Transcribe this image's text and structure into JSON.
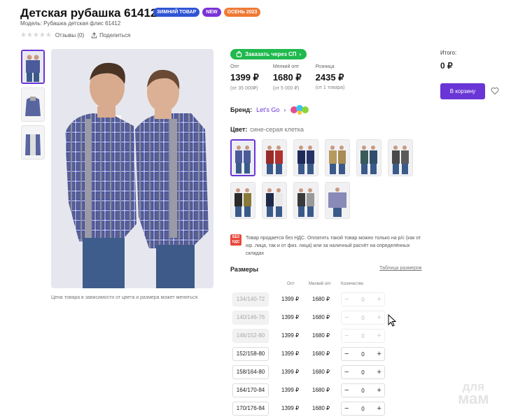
{
  "product": {
    "title": "Детская рубашка 61412",
    "badges": [
      "ЗИМНИЙ ТОВАР",
      "NEW",
      "ОСЕНЬ 2023"
    ],
    "model": "Модель: Рубашка детская флис 61412",
    "reviews": "Отзывы (0)",
    "share": "Поделиться",
    "image_caption": "Цена товара в зависимости от цвета и размера может меняться"
  },
  "offer": {
    "sp_button": "Заказать через СП",
    "prices": [
      {
        "label": "Опт",
        "value": "1399 ₽",
        "sub": "(от 35 000₽)"
      },
      {
        "label": "Мелкий опт",
        "value": "1680 ₽",
        "sub": "(от 5 000 ₽)"
      },
      {
        "label": "Розница",
        "value": "2435 ₽",
        "sub": "(от 1 товара)"
      }
    ],
    "brand_label": "Бренд:",
    "brand_name": "Let's Go",
    "color_label": "Цвет:",
    "color_value": "сине-серая клетка",
    "swatch_count": 11,
    "notice": "Товар продается без НДС. Оплатить такой товар можно только на р/с (как от юр. лица, так и от физ. лица) или за наличный расчёт на определённых складах",
    "nds_badge": [
      "БЕЗ",
      "НДС"
    ]
  },
  "sizes": {
    "heading": "Размеры",
    "table_link": "Таблица размеров",
    "col_opt": "Опт",
    "col_small": "Мелкий опт",
    "col_qty": "Количество",
    "rows": [
      {
        "size": "134/140-72",
        "opt": "1399 ₽",
        "small": "1680 ₽",
        "qty": "0",
        "disabled": true
      },
      {
        "size": "140/146-76",
        "opt": "1399 ₽",
        "small": "1680 ₽",
        "qty": "0",
        "disabled": true
      },
      {
        "size": "146/152-80",
        "opt": "1399 ₽",
        "small": "1680 ₽",
        "qty": "0",
        "disabled": true
      },
      {
        "size": "152/158-80",
        "opt": "1399 ₽",
        "small": "1680 ₽",
        "qty": "0",
        "disabled": false
      },
      {
        "size": "158/164-80",
        "opt": "1399 ₽",
        "small": "1680 ₽",
        "qty": "0",
        "disabled": false
      },
      {
        "size": "164/170-84",
        "opt": "1399 ₽",
        "small": "1680 ₽",
        "qty": "0",
        "disabled": false
      },
      {
        "size": "170/176-84",
        "opt": "1399 ₽",
        "small": "1680 ₽",
        "qty": "0",
        "disabled": false
      }
    ]
  },
  "summary": {
    "total_label": "Итого:",
    "total_value": "0 ₽",
    "cart_button": "В корзину"
  },
  "watermark": [
    "для",
    "мам"
  ],
  "colors": {
    "accent": "#6a35d6",
    "green": "#20b94e",
    "nds": "#e9483b"
  }
}
